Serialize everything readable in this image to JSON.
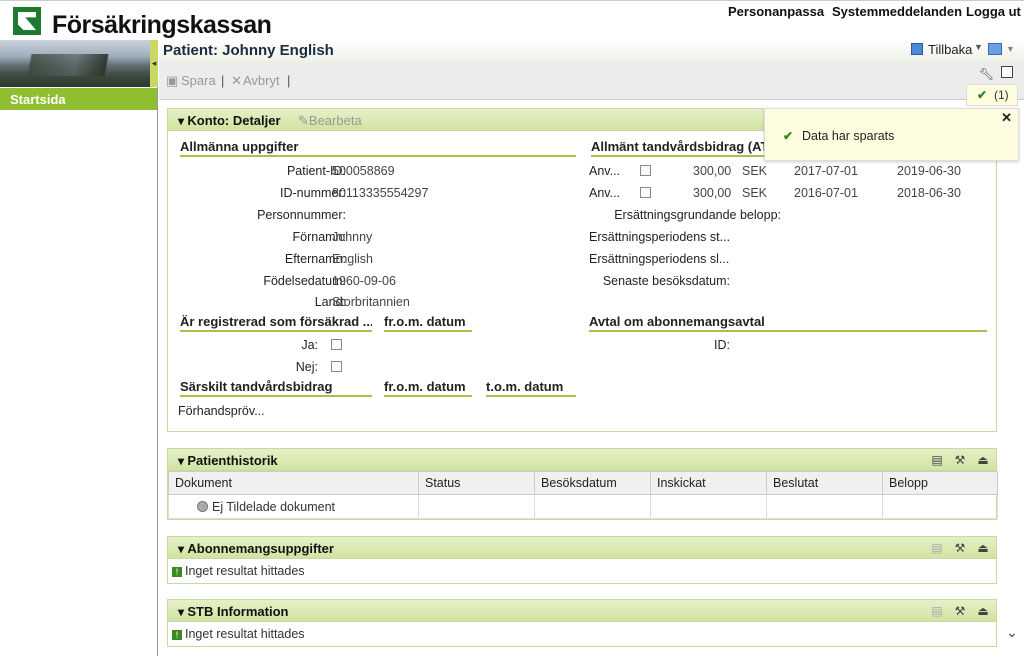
{
  "brand": {
    "name": "Försäkringskassan"
  },
  "top_links": [
    "Personanpassa",
    "Systemmeddelanden",
    "Logga ut"
  ],
  "nav": {
    "items": [
      {
        "label": "Startsida"
      }
    ]
  },
  "page": {
    "title": "Patient: Johnny English",
    "back_label": "Tillbaka"
  },
  "toolbar": {
    "save": "Spara",
    "cancel": "Avbryt"
  },
  "notification": {
    "count": "(1)",
    "message": "Data har sparats"
  },
  "konto": {
    "title": "Konto: Detaljer",
    "edit": "Bearbeta",
    "general_title": "Allmänna uppgifter",
    "fields": [
      {
        "label": "Patient-ID:",
        "value": "500058869"
      },
      {
        "label": "ID-nummer:",
        "value": "80113335554297"
      },
      {
        "label": "Personnummer:",
        "value": ""
      },
      {
        "label": "Förnamn:",
        "value": "Johnny"
      },
      {
        "label": "Efternamn:",
        "value": "English"
      },
      {
        "label": "Födelsedatum:",
        "value": "1960-09-06"
      },
      {
        "label": "Land:",
        "value": "Storbritannien"
      }
    ],
    "atb_title": "Allmänt tandvårdsbidrag (ATB",
    "atb_rows": [
      {
        "type": "Anv...",
        "amount": "300,00",
        "currency": "SEK",
        "from": "2017-07-01",
        "to": "2019-06-30"
      },
      {
        "type": "Anv...",
        "amount": "300,00",
        "currency": "SEK",
        "from": "2016-07-01",
        "to": "2018-06-30"
      }
    ],
    "atb_fields": [
      "Ersättningsgrundande belopp:",
      "Ersättningsperiodens st...",
      "Ersättningsperiodens sl...",
      "Senaste besöksdatum:"
    ],
    "reg_title": "Är registrerad som försäkrad ...",
    "from_date": "fr.o.m. datum",
    "reg_options": [
      "Ja:",
      "Nej:"
    ],
    "abo_title": "Avtal om abonnemangsavtal",
    "abo_id": "ID:",
    "stb_title": "Särskilt tandvårdsbidrag",
    "to_date": "t.o.m. datum",
    "forhand": "Förhandspröv..."
  },
  "history": {
    "title": "Patienthistorik",
    "columns": [
      "Dokument",
      "Status",
      "Besöksdatum",
      "Inskickat",
      "Beslutat",
      "Belopp"
    ],
    "rows": [
      {
        "doc": "Ej Tildelade dokument"
      }
    ]
  },
  "abonnemang": {
    "title": "Abonnemangsuppgifter",
    "empty": "Inget resultat hittades"
  },
  "stb": {
    "title": "STB Information",
    "empty": "Inget resultat hittades"
  }
}
